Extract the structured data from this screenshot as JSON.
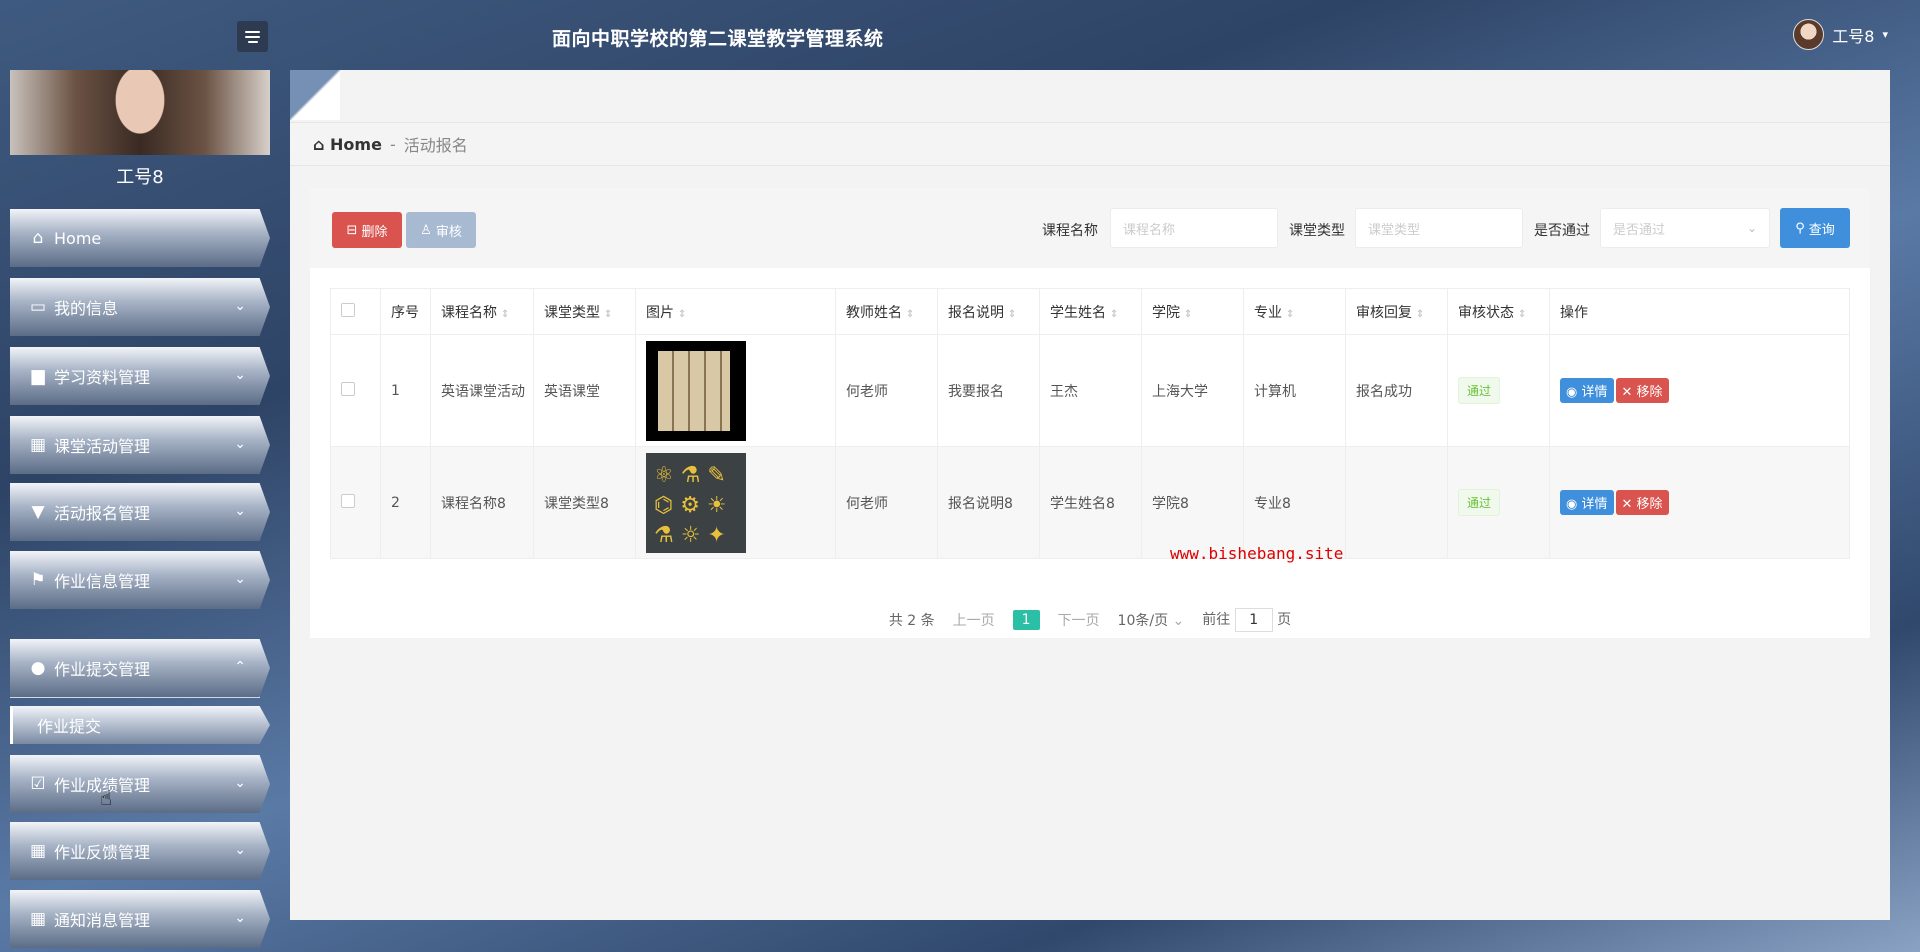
{
  "header": {
    "title": "面向中职学校的第二课堂教学管理系统",
    "username": "工号8",
    "caret": "▾",
    "toggle_icon": "menu-toggle-icon"
  },
  "sidebar": {
    "profile_name": "工号8",
    "items": [
      {
        "label": "Home",
        "icon": "⌂"
      },
      {
        "label": "我的信息",
        "icon": "▭"
      },
      {
        "label": "学习资料管理",
        "icon": "▆"
      },
      {
        "label": "课堂活动管理",
        "icon": "▦"
      },
      {
        "label": "活动报名管理",
        "icon": "▼"
      },
      {
        "label": "作业信息管理",
        "icon": "⚑"
      },
      {
        "label": "作业提交管理",
        "icon": "●"
      },
      {
        "label": "作业成绩管理",
        "icon": "☑"
      },
      {
        "label": "作业反馈管理",
        "icon": "▦"
      },
      {
        "label": "通知消息管理",
        "icon": "▦"
      }
    ],
    "sub_item": "作业提交",
    "chev_down": "⌄",
    "chev_up": "⌃"
  },
  "breadcrumb": {
    "home": "Home",
    "sep": "-",
    "current": "活动报名"
  },
  "toolbar": {
    "delete_label": "删除",
    "audit_label": "审核",
    "query_label": "查询",
    "filters": [
      {
        "label": "课程名称",
        "placeholder": "课程名称"
      },
      {
        "label": "课堂类型",
        "placeholder": "课堂类型"
      },
      {
        "label": "是否通过",
        "placeholder": "是否通过"
      }
    ]
  },
  "table": {
    "columns": [
      "序号",
      "课程名称",
      "课堂类型",
      "图片",
      "教师姓名",
      "报名说明",
      "学生姓名",
      "学院",
      "专业",
      "审核回复",
      "审核状态",
      "操作"
    ],
    "rows": [
      {
        "no": "1",
        "course": "英语课堂活动",
        "type": "英语课堂",
        "teacher": "何老师",
        "note": "我要报名",
        "student": "王杰",
        "college": "上海大学",
        "major": "计算机",
        "reply": "报名成功",
        "status": "通过"
      },
      {
        "no": "2",
        "course": "课程名称8",
        "type": "课堂类型8",
        "teacher": "何老师",
        "note": "报名说明8",
        "student": "学生姓名8",
        "college": "学院8",
        "major": "专业8",
        "reply": "",
        "status": "通过"
      }
    ],
    "detail_label": "详情",
    "remove_label": "移除"
  },
  "watermark": "www.bishebang.site",
  "pager": {
    "total": "共 2 条",
    "prev": "上一页",
    "current": "1",
    "next": "下一页",
    "size": "10条/页",
    "goto": "前往",
    "goto_value": "1",
    "page_unit": "页"
  }
}
